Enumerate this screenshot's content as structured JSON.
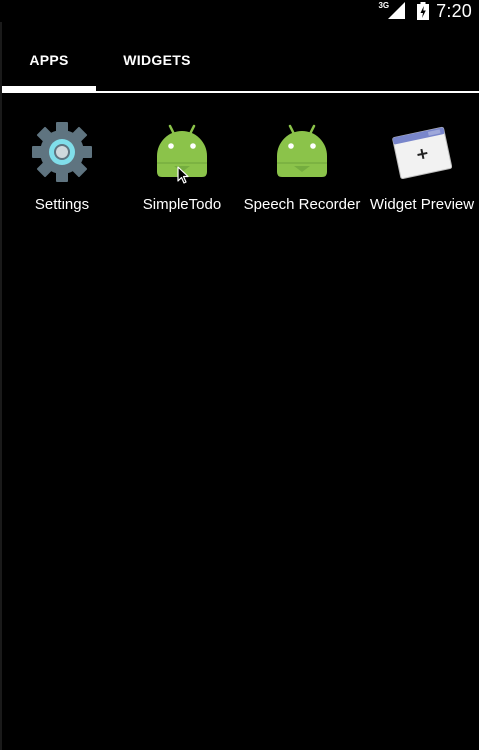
{
  "status_bar": {
    "network_type": "3G",
    "time": "7:20",
    "icons": [
      "signal-icon",
      "battery-icon"
    ]
  },
  "tabs": [
    {
      "label": "APPS",
      "selected": true
    },
    {
      "label": "WIDGETS",
      "selected": false
    }
  ],
  "apps": [
    {
      "label": "Settings",
      "icon": "settings-gear-icon"
    },
    {
      "label": "SimpleTodo",
      "icon": "android-robot-icon"
    },
    {
      "label": "Speech Recorder",
      "icon": "android-robot-icon"
    },
    {
      "label": "Widget Preview",
      "icon": "widget-preview-icon"
    }
  ],
  "colors": {
    "background": "#000000",
    "text": "#ffffff",
    "android_green": "#8BC34A",
    "gear_gray": "#5F7480",
    "gear_center_teal": "#80DEEA"
  }
}
